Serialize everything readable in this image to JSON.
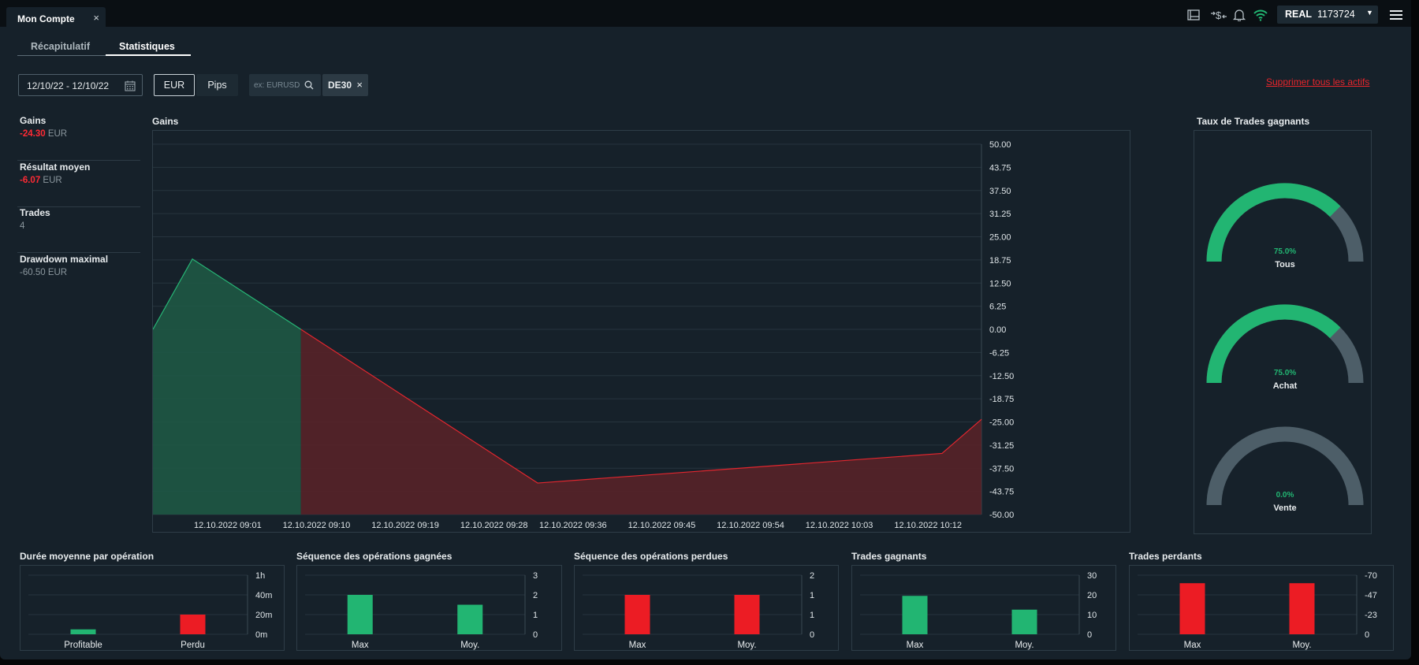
{
  "window": {
    "tab_title": "Mon Compte",
    "close_glyph": "×"
  },
  "topbar": {
    "icons": [
      "layout-icon",
      "dollar-transfer-icon",
      "bell-icon",
      "wifi-icon"
    ],
    "account_type": "REAL",
    "account_number": "1173724",
    "caret": "▼"
  },
  "subtabs": [
    {
      "label": "Récapitulatif",
      "active": false
    },
    {
      "label": "Statistiques",
      "active": true
    }
  ],
  "filters": {
    "date_range": "12/10/22 - 12/10/22",
    "unit_options": [
      {
        "label": "EUR",
        "selected": true
      },
      {
        "label": "Pips",
        "selected": false
      }
    ],
    "search_placeholder": "ex: EURUSD",
    "search_value": "",
    "tags": [
      {
        "label": "DE30",
        "remove_glyph": "×"
      }
    ],
    "clear_all_label": "Supprimer tous les actifs"
  },
  "summary": [
    {
      "label": "Gains",
      "value": "-24.30",
      "unit": "EUR",
      "negative": true
    },
    {
      "label": "Résultat moyen",
      "value": "-6.07",
      "unit": "EUR",
      "negative": true
    },
    {
      "label": "Trades",
      "value": "4",
      "unit": "",
      "negative": false
    },
    {
      "label": "Drawdown maximal",
      "value": "-60.50",
      "unit": "EUR",
      "negative": false
    }
  ],
  "colors": {
    "positive": "#22b572",
    "negative": "#ec1c24",
    "gauge_track": "#4d5e68",
    "accent_link": "#e8252b"
  },
  "win_rate": {
    "title": "Taux de Trades gagnants",
    "gauges": [
      {
        "label": "Tous",
        "value": 0.75,
        "display": "75.0%"
      },
      {
        "label": "Achat",
        "value": 0.75,
        "display": "75.0%"
      },
      {
        "label": "Vente",
        "value": 0.0,
        "display": "0.0%"
      }
    ]
  },
  "chart_data": [
    {
      "type": "area",
      "title": "Gains",
      "x_tick_labels": [
        "12.10.2022 09:01",
        "12.10.2022 09:10",
        "12.10.2022 09:19",
        "12.10.2022 09:28",
        "12.10.2022 09:36",
        "12.10.2022 09:45",
        "12.10.2022 09:54",
        "12.10.2022 10:03",
        "12.10.2022 10:12"
      ],
      "y_tick_labels": [
        "50.00",
        "43.75",
        "37.50",
        "31.25",
        "25.00",
        "18.75",
        "12.50",
        "6.25",
        "0.00",
        "-6.25",
        "-12.50",
        "-18.75",
        "-25.00",
        "-31.25",
        "-37.50",
        "-43.75",
        "-50.00"
      ],
      "ylim": [
        -50,
        50
      ],
      "x": [
        "12.10.2022 08:57",
        "12.10.2022 09:01",
        "12.10.2022 09:12",
        "12.10.2022 09:36",
        "12.10.2022 10:17",
        "12.10.2022 10:21"
      ],
      "values": [
        0,
        19,
        0,
        -41.5,
        -33.5,
        -24.3
      ],
      "positive_until": "12.10.2022 09:12",
      "grid": true
    },
    {
      "type": "bar",
      "title": "Durée moyenne par opération",
      "categories": [
        "Profitable",
        "Perdu"
      ],
      "values": [
        5,
        20
      ],
      "value_unit": "minutes",
      "y_tick_labels": [
        "1h",
        "40m",
        "20m",
        "0m"
      ],
      "ylim": [
        0,
        60
      ],
      "bar_colors": [
        "#22b572",
        "#ec1c24"
      ]
    },
    {
      "type": "bar",
      "title": "Séquence des opérations gagnées",
      "categories": [
        "Max",
        "Moy."
      ],
      "values": [
        2,
        1.5
      ],
      "y_tick_labels": [
        "3",
        "2",
        "1",
        "0"
      ],
      "ylim": [
        0,
        3
      ],
      "bar_colors": [
        "#22b572",
        "#22b572"
      ]
    },
    {
      "type": "bar",
      "title": "Séquence des opérations perdues",
      "categories": [
        "Max",
        "Moy."
      ],
      "values": [
        1,
        1
      ],
      "y_tick_labels": [
        "2",
        "1",
        "1",
        "0"
      ],
      "ylim": [
        0,
        1.5
      ],
      "bar_colors": [
        "#ec1c24",
        "#ec1c24"
      ]
    },
    {
      "type": "bar",
      "title": "Trades gagnants",
      "categories": [
        "Max",
        "Moy."
      ],
      "values": [
        19.5,
        12.5
      ],
      "y_tick_labels": [
        "30",
        "20",
        "10",
        "0"
      ],
      "ylim": [
        0,
        30
      ],
      "bar_colors": [
        "#22b572",
        "#22b572"
      ]
    },
    {
      "type": "bar",
      "title": "Trades perdants",
      "categories": [
        "Max",
        "Moy."
      ],
      "values": [
        -60.5,
        -60.5
      ],
      "y_tick_labels": [
        "-70",
        "-47",
        "-23",
        "0"
      ],
      "ylim": [
        -70,
        0
      ],
      "bar_colors": [
        "#ec1c24",
        "#ec1c24"
      ]
    }
  ]
}
